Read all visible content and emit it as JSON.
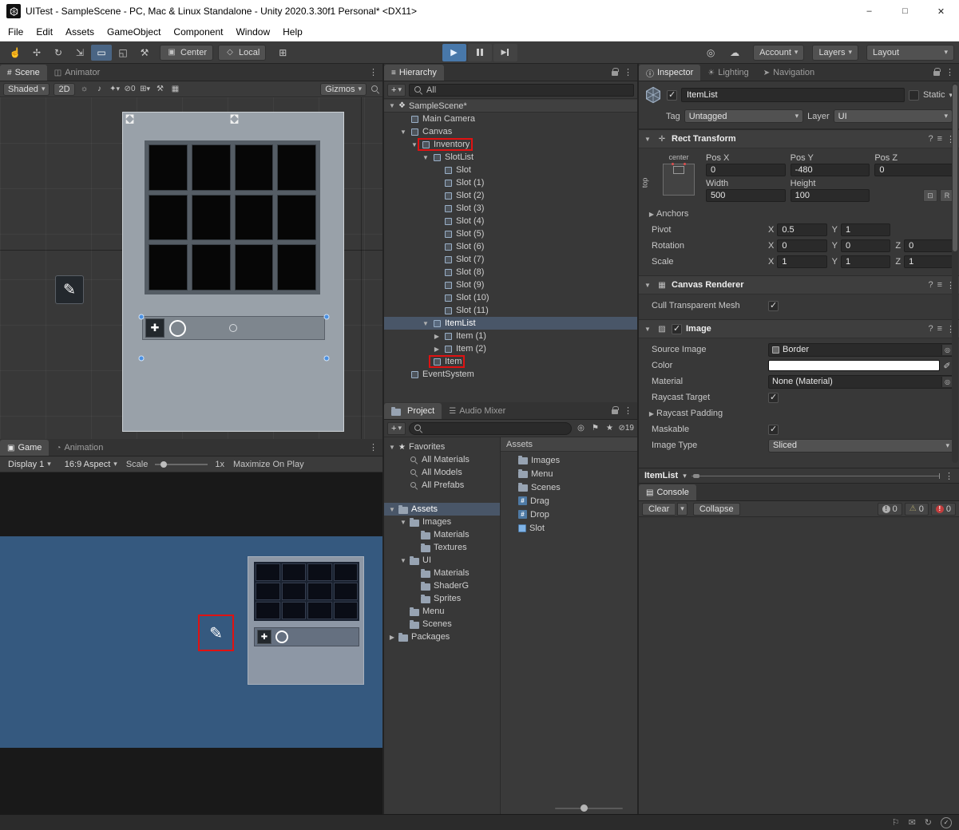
{
  "colors": {
    "highlight_red": "#e01212",
    "selection_blue": "#4a90e2",
    "play_active_blue": "#4878aa",
    "game_background_blue": "#35597f"
  },
  "titlebar": {
    "title": "UITest - SampleScene - PC, Mac & Linux Standalone - Unity 2020.3.30f1 Personal* <DX11>",
    "minimize": "–",
    "maximize": "□",
    "close": "✕"
  },
  "menubar": {
    "items": [
      "File",
      "Edit",
      "Assets",
      "GameObject",
      "Component",
      "Window",
      "Help"
    ]
  },
  "toolbar": {
    "center": "Center",
    "local": "Local",
    "account": "Account",
    "layers": "Layers",
    "layout": "Layout"
  },
  "scene_panel": {
    "tab_scene": "Scene",
    "tab_animator": "Animator",
    "shaded": "Shaded",
    "mode_2d": "2D",
    "hidden_count": "0",
    "gizmos": "Gizmos"
  },
  "scene_mockup": {
    "slot_count": 12
  },
  "game_panel": {
    "tab_game": "Game",
    "tab_animation": "Animation",
    "display": "Display 1",
    "aspect": "16:9 Aspect",
    "scale_label": "Scale",
    "scale_value": "1x",
    "maximize": "Maximize On Play"
  },
  "game_mockup": {
    "slot_count": 12
  },
  "hierarchy": {
    "tab": "Hierarchy",
    "search_value": "All",
    "items": [
      {
        "label": "SampleScene*",
        "depth": 0,
        "arrow": "open",
        "icon": "unity",
        "header": true
      },
      {
        "label": "Main Camera",
        "depth": 1,
        "icon": "cube"
      },
      {
        "label": "Canvas",
        "depth": 1,
        "arrow": "open",
        "icon": "cube"
      },
      {
        "label": "Inventory",
        "depth": 2,
        "arrow": "open",
        "icon": "cube",
        "redbox": true
      },
      {
        "label": "SlotList",
        "depth": 3,
        "arrow": "open",
        "icon": "cube"
      },
      {
        "label": "Slot",
        "depth": 4,
        "icon": "cube"
      },
      {
        "label": "Slot (1)",
        "depth": 4,
        "icon": "cube"
      },
      {
        "label": "Slot (2)",
        "depth": 4,
        "icon": "cube"
      },
      {
        "label": "Slot (3)",
        "depth": 4,
        "icon": "cube"
      },
      {
        "label": "Slot (4)",
        "depth": 4,
        "icon": "cube"
      },
      {
        "label": "Slot (5)",
        "depth": 4,
        "icon": "cube"
      },
      {
        "label": "Slot (6)",
        "depth": 4,
        "icon": "cube"
      },
      {
        "label": "Slot (7)",
        "depth": 4,
        "icon": "cube"
      },
      {
        "label": "Slot (8)",
        "depth": 4,
        "icon": "cube"
      },
      {
        "label": "Slot (9)",
        "depth": 4,
        "icon": "cube"
      },
      {
        "label": "Slot (10)",
        "depth": 4,
        "icon": "cube"
      },
      {
        "label": "Slot (11)",
        "depth": 4,
        "icon": "cube"
      },
      {
        "label": "ItemList",
        "depth": 3,
        "arrow": "open",
        "icon": "cube",
        "selected": true
      },
      {
        "label": "Item (1)",
        "depth": 4,
        "arrow": "closed",
        "icon": "cube"
      },
      {
        "label": "Item (2)",
        "depth": 4,
        "arrow": "closed",
        "icon": "cube"
      },
      {
        "label": "Item",
        "depth": 3,
        "icon": "cube",
        "redbox": true
      },
      {
        "label": "EventSystem",
        "depth": 1,
        "icon": "cube"
      }
    ]
  },
  "project": {
    "tab_project": "Project",
    "tab_mixer": "Audio Mixer",
    "hidden_count": "19",
    "assets_header": "Assets",
    "tree": [
      {
        "label": "Favorites",
        "depth": 0,
        "arrow": "open",
        "icon": "star"
      },
      {
        "label": "All Materials",
        "depth": 1,
        "icon": "mag"
      },
      {
        "label": "All Models",
        "depth": 1,
        "icon": "mag"
      },
      {
        "label": "All Prefabs",
        "depth": 1,
        "icon": "mag"
      },
      {
        "spacer": true
      },
      {
        "label": "Assets",
        "depth": 0,
        "arrow": "open",
        "icon": "folder",
        "selected": true
      },
      {
        "label": "Images",
        "depth": 1,
        "arrow": "open",
        "icon": "folder"
      },
      {
        "label": "Materials",
        "depth": 2,
        "icon": "folder"
      },
      {
        "label": "Textures",
        "depth": 2,
        "icon": "folder"
      },
      {
        "label": "UI",
        "depth": 1,
        "arrow": "open",
        "icon": "folder"
      },
      {
        "label": "Materials",
        "depth": 2,
        "icon": "folder"
      },
      {
        "label": "ShaderG",
        "depth": 2,
        "icon": "folder"
      },
      {
        "label": "Sprites",
        "depth": 2,
        "icon": "folder"
      },
      {
        "label": "Menu",
        "depth": 1,
        "icon": "folder"
      },
      {
        "label": "Scenes",
        "depth": 1,
        "icon": "folder"
      },
      {
        "label": "Packages",
        "depth": 0,
        "arrow": "closed",
        "icon": "folder"
      }
    ],
    "assets": [
      {
        "label": "Images",
        "depth": 0,
        "icon": "folder"
      },
      {
        "label": "Menu",
        "depth": 0,
        "icon": "folder"
      },
      {
        "label": "Scenes",
        "depth": 0,
        "icon": "folder"
      },
      {
        "label": "Drag",
        "depth": 0,
        "icon": "script"
      },
      {
        "label": "Drop",
        "depth": 0,
        "icon": "script"
      },
      {
        "label": "Slot",
        "depth": 0,
        "icon": "prefab"
      }
    ]
  },
  "inspector": {
    "tab_inspector": "Inspector",
    "tab_lighting": "Lighting",
    "tab_navigation": "Navigation",
    "name": "ItemList",
    "static_label": "Static",
    "tag_label": "Tag",
    "tag_value": "Untagged",
    "layer_label": "Layer",
    "layer_value": "UI",
    "rect_transform": {
      "title": "Rect Transform",
      "anchor_h": "center",
      "anchor_v": "top",
      "pos_x_label": "Pos X",
      "pos_y_label": "Pos Y",
      "pos_z_label": "Pos Z",
      "pos_x": "0",
      "pos_y": "-480",
      "pos_z": "0",
      "width_label": "Width",
      "height_label": "Height",
      "width": "500",
      "height": "100",
      "r_button": "R",
      "anchors_label": "Anchors",
      "pivot_label": "Pivot",
      "rotation_label": "Rotation",
      "scale_label": "Scale",
      "x": "X",
      "y": "Y",
      "z": "Z",
      "pivot_x": "0.5",
      "pivot_y": "1",
      "rot_x": "0",
      "rot_y": "0",
      "rot_z": "0",
      "scale_x": "1",
      "scale_y": "1",
      "scale_z": "1"
    },
    "canvas_renderer": {
      "title": "Canvas Renderer",
      "cull_label": "Cull Transparent Mesh"
    },
    "image": {
      "title": "Image",
      "source_label": "Source Image",
      "source_value": "Border",
      "color_label": "Color",
      "material_label": "Material",
      "material_value": "None (Material)",
      "raycast_label": "Raycast Target",
      "padding_label": "Raycast Padding",
      "maskable_label": "Maskable",
      "type_label": "Image Type",
      "type_value": "Sliced"
    }
  },
  "itemlist_bar": {
    "label": "ItemList"
  },
  "console": {
    "tab": "Console",
    "clear": "Clear",
    "collapse": "Collapse",
    "info_count": "0",
    "warning_count": "0",
    "error_count": "0"
  }
}
